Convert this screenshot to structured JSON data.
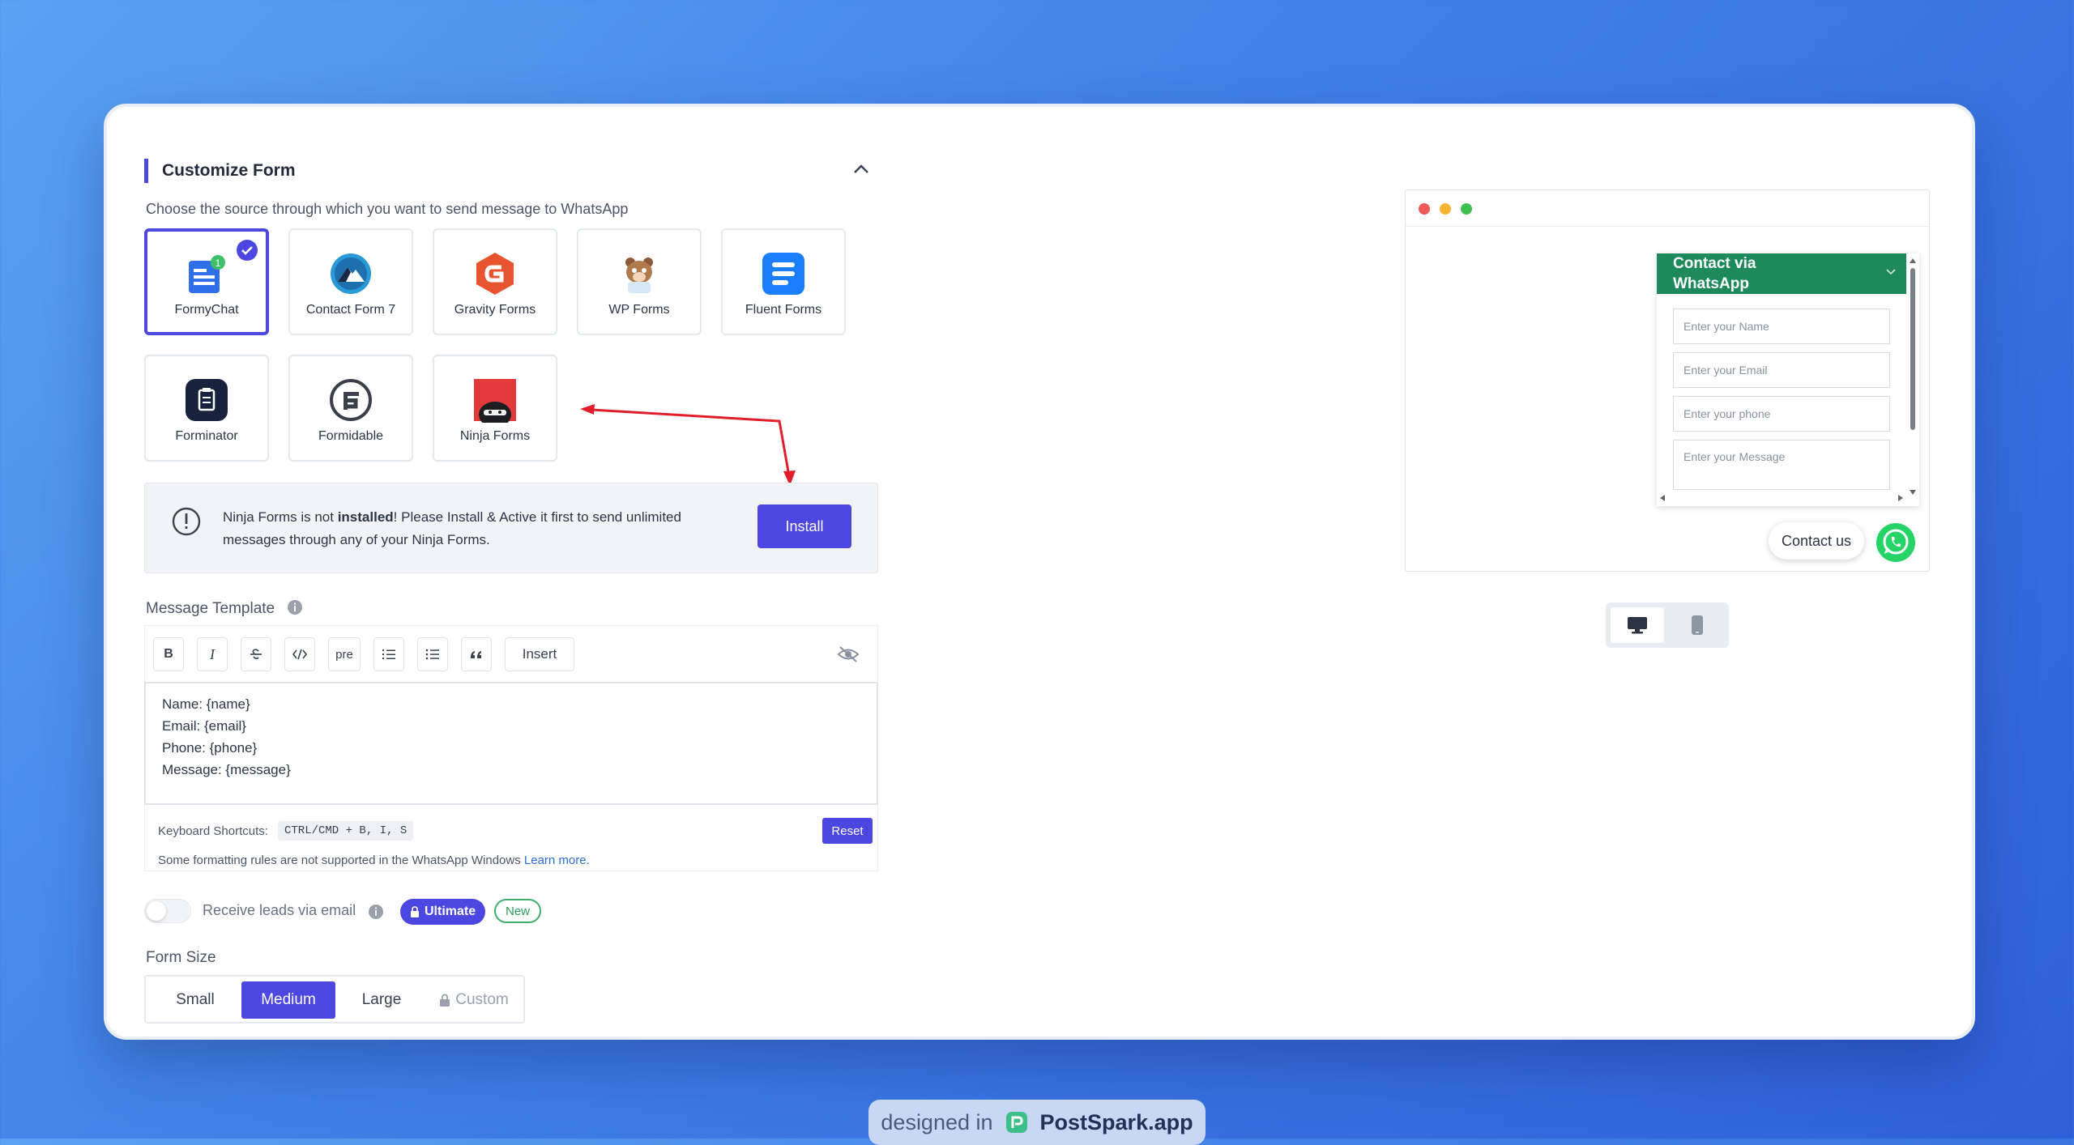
{
  "header": {
    "title": "Customize Form",
    "subtitle": "Choose the source through which you want to send message to WhatsApp"
  },
  "sources": [
    {
      "label": "FormyChat",
      "selected": true,
      "icon": "formychat-icon",
      "badge": "1"
    },
    {
      "label": "Contact Form 7",
      "icon": "contact-form-7-icon"
    },
    {
      "label": "Gravity Forms",
      "icon": "gravity-forms-icon"
    },
    {
      "label": "WP Forms",
      "icon": "wp-forms-icon"
    },
    {
      "label": "Fluent Forms",
      "icon": "fluent-forms-icon"
    },
    {
      "label": "Forminator",
      "icon": "forminator-icon"
    },
    {
      "label": "Formidable",
      "icon": "formidable-icon"
    },
    {
      "label": "Ninja Forms",
      "icon": "ninja-forms-icon"
    }
  ],
  "alert": {
    "text_before": "Ninja Forms is not ",
    "text_bold": "installed",
    "text_after": "! Please Install & Active it first to send unlimited messages through any of your Ninja Forms.",
    "button": "Install"
  },
  "template": {
    "label": "Message Template",
    "toolbar": {
      "bold": "B",
      "italic": "I",
      "pre": "pre",
      "insert": "Insert"
    },
    "lines": [
      "Name: {name}",
      "Email: {email}",
      "Phone: {phone}",
      "Message: {message}"
    ],
    "shortcuts_label": "Keyboard Shortcuts:",
    "shortcuts_value": "CTRL/CMD + B, I, S",
    "reset": "Reset",
    "note": "Some formatting rules are not supported in the WhatsApp Windows",
    "learn_more": "Learn more."
  },
  "leads": {
    "label": "Receive leads via email",
    "enabled": false,
    "ultimate": "Ultimate",
    "new": "New"
  },
  "form_size": {
    "label": "Form Size",
    "options": [
      "Small",
      "Medium",
      "Large",
      "Custom"
    ],
    "selected": "Medium"
  },
  "preview": {
    "widget_title": "Contact via WhatsApp",
    "fields": [
      "Enter your Name",
      "Enter your Email",
      "Enter your phone",
      "Enter your Message"
    ],
    "contact_label": "Contact us",
    "selected_device": "desktop"
  },
  "footer": {
    "designed": "designed in",
    "brand": "PostSpark.app"
  },
  "colors": {
    "accent": "#4b47e0",
    "whatsapp": "#1e8a5c",
    "whatsapp_fab": "#25d366"
  }
}
